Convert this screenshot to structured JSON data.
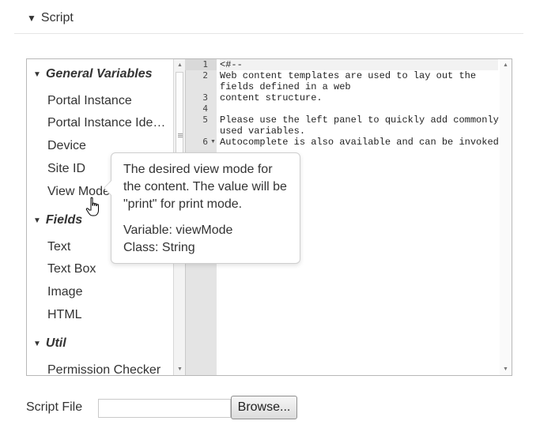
{
  "section": {
    "title": "Script"
  },
  "side_panel": {
    "categories": [
      {
        "label": "General Variables",
        "items": [
          "Portal Instance",
          "Portal Instance Ide…",
          "Device",
          "Site ID",
          "View Mode"
        ]
      },
      {
        "label": "Fields",
        "items": [
          "Text",
          "Text Box",
          "Image",
          "HTML"
        ]
      },
      {
        "label": "Util",
        "items": [
          "Permission Checker"
        ]
      }
    ]
  },
  "editor": {
    "line_numbers": [
      "1",
      "2",
      "",
      "3",
      "4",
      "5",
      "",
      "6"
    ],
    "lines": [
      "<#--",
      "Web content templates are used to lay out the",
      "fields defined in a web",
      "content structure.",
      "",
      "Please use the left panel to quickly add commonly",
      "used variables.",
      "Autocomplete is also available and can be invoked"
    ]
  },
  "tooltip": {
    "description": "The desired view mode for the content. The value will be \"print\" for print mode.",
    "variable": "Variable: viewMode",
    "class": "Class: String"
  },
  "script_file": {
    "label": "Script File",
    "value": "",
    "browse_label": "Browse..."
  },
  "icons": {
    "section_toggle": "triangle-down-icon",
    "category_toggle": "caret-down-icon",
    "fold": "fold-caret-icon",
    "cursor": "hand-pointer-icon"
  }
}
